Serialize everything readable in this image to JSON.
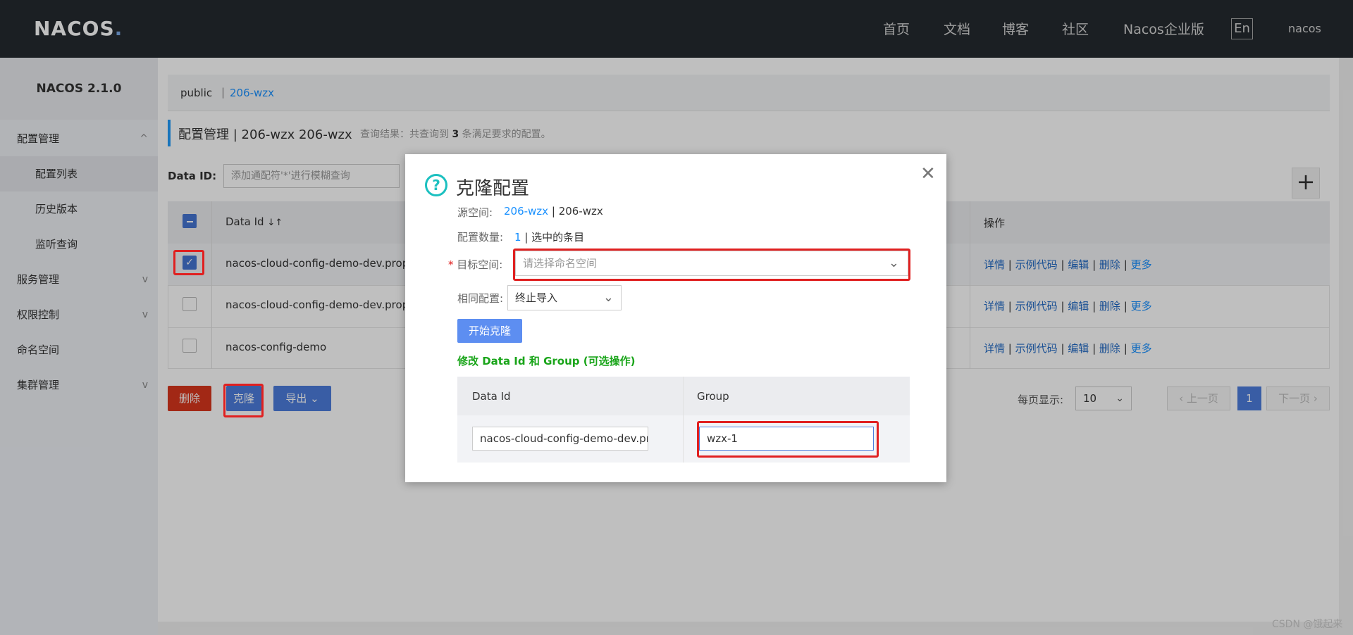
{
  "header": {
    "logo": "NACOS",
    "nav": [
      "首页",
      "文档",
      "博客",
      "社区",
      "Nacos企业版"
    ],
    "lang": "En",
    "user": "nacos"
  },
  "sidebar": {
    "version": "NACOS 2.1.0",
    "items": [
      {
        "label": "配置管理",
        "chevron": "^"
      },
      {
        "label": "配置列表"
      },
      {
        "label": "历史版本"
      },
      {
        "label": "监听查询"
      },
      {
        "label": "服务管理",
        "chevron": "v"
      },
      {
        "label": "权限控制",
        "chevron": "v"
      },
      {
        "label": "命名空间"
      },
      {
        "label": "集群管理",
        "chevron": "v"
      }
    ]
  },
  "namespace_bar": {
    "public": "public",
    "separator": "|",
    "current": "206-wzx"
  },
  "page_title": {
    "title": "配置管理",
    "sep": "|",
    "ns1": "206-wzx",
    "ns2": "206-wzx",
    "summary_pre": "查询结果：共查询到",
    "summary_count": "3",
    "summary_post": "条满足要求的配置。"
  },
  "search": {
    "label": "Data ID:",
    "placeholder": "添加通配符'*'进行模糊查询"
  },
  "add_button": "+",
  "table": {
    "headers": {
      "data_id": "Data Id",
      "sort": "↓↑",
      "actions": "操作"
    },
    "rows": [
      {
        "data_id": "nacos-cloud-config-demo-dev.properties",
        "checked": true
      },
      {
        "data_id": "nacos-cloud-config-demo-dev.properties",
        "checked": false
      },
      {
        "data_id": "nacos-config-demo",
        "checked": false
      }
    ],
    "actions": {
      "detail": "详情",
      "sample": "示例代码",
      "edit": "编辑",
      "delete": "删除",
      "more": "更多",
      "sep": "|"
    }
  },
  "bottom_buttons": {
    "delete": "删除",
    "clone": "克隆",
    "export": "导出"
  },
  "pagination": {
    "per_page_label": "每页显示:",
    "per_page": "10",
    "prev": "上一页",
    "page": "1",
    "next": "下一页"
  },
  "dialog": {
    "title": "克隆配置",
    "source_label": "源空间:",
    "source_ns": "206-wzx",
    "source_sep": "|",
    "source_name": "206-wzx",
    "count_label": "配置数量:",
    "count_val": "1",
    "count_sep": "|",
    "count_text": "选中的条目",
    "target_label": "目标空间:",
    "target_placeholder": "请选择命名空间",
    "same_label": "相同配置:",
    "same_value": "终止导入",
    "start_button": "开始克隆",
    "modify_label": "修改 Data Id 和 Group (可选操作)",
    "col_data_id": "Data Id",
    "col_group": "Group",
    "row_data_id": "nacos-cloud-config-demo-dev.properties",
    "row_group": "wzx-1"
  },
  "watermark": "CSDN @饿起来",
  "colors": {
    "accent": "#4c7ddd",
    "danger": "#d9361d",
    "link": "#1890ff",
    "highlight": "#e02020"
  }
}
